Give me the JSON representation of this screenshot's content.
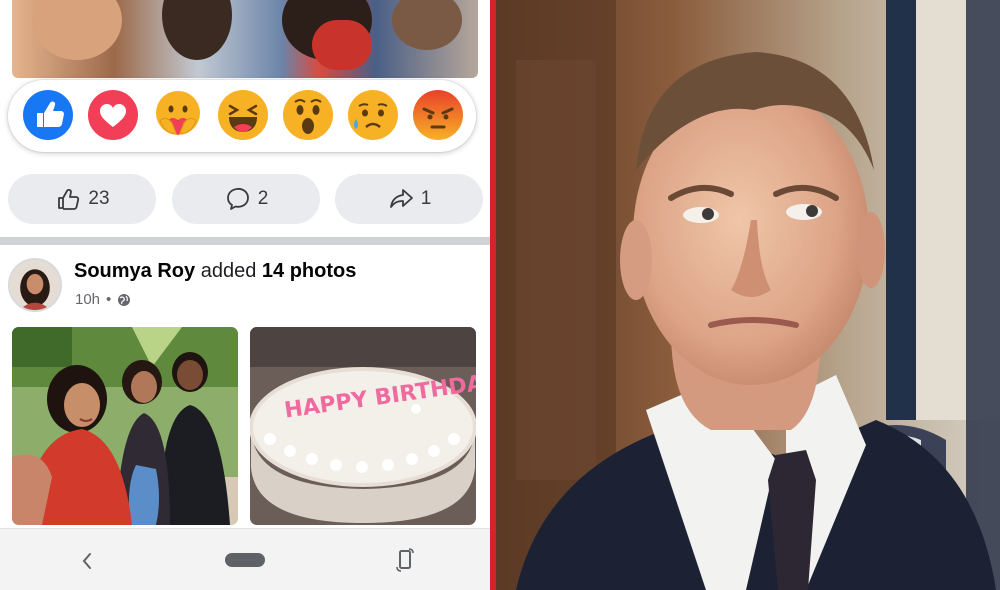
{
  "reactions": [
    {
      "name": "like",
      "color": "#1877f2"
    },
    {
      "name": "love",
      "color": "#f33e58"
    },
    {
      "name": "care",
      "color": "#f7b125"
    },
    {
      "name": "haha",
      "color": "#f7b125"
    },
    {
      "name": "wow",
      "color": "#f7b125"
    },
    {
      "name": "sad",
      "color": "#f7b125"
    },
    {
      "name": "angry",
      "color": "#e9710f"
    }
  ],
  "actions": {
    "like_count": "23",
    "comment_count": "2",
    "share_count": "1"
  },
  "post": {
    "author": "Soumya Roy",
    "verb": "added",
    "object": "14 photos",
    "time": "10h",
    "separator": "•",
    "privacy_icon": "globe-icon"
  },
  "cake_text": "HAPPY BIRTHDAY",
  "nav": {
    "back_icon": "back-chevron-icon",
    "home_icon": "home-pill-icon",
    "rotate_icon": "rotate-icon"
  },
  "colors": {
    "separator": "#d62229",
    "pill_bg": "#e9ebee",
    "text_primary": "#050505",
    "text_secondary": "#65676b"
  }
}
